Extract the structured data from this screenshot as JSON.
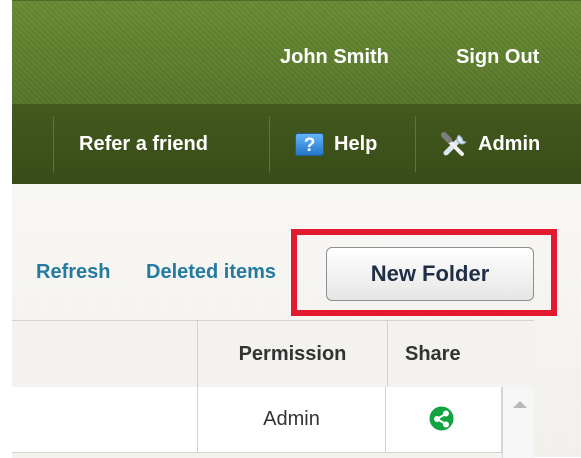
{
  "header": {
    "user_name": "John Smith",
    "sign_out": "Sign Out"
  },
  "nav": {
    "items": [
      {
        "label": "Refer a friend",
        "icon": ""
      },
      {
        "label": "Help",
        "icon": "help-icon"
      },
      {
        "label": "Admin",
        "icon": "tools-icon"
      }
    ]
  },
  "toolbar": {
    "refresh": "Refresh",
    "deleted_items": "Deleted items",
    "new_folder": "New Folder"
  },
  "table": {
    "columns": [
      "Permission",
      "Share"
    ],
    "rows": [
      {
        "permission": "Admin",
        "share_icon": "share-icon"
      }
    ]
  },
  "icons": {
    "help_glyph": "?"
  },
  "colors": {
    "highlight": "#e2192f",
    "link": "#247a9f",
    "top_bar": "#5d7d2c",
    "nav_bar": "#3e521c",
    "share_green": "#13a442"
  }
}
